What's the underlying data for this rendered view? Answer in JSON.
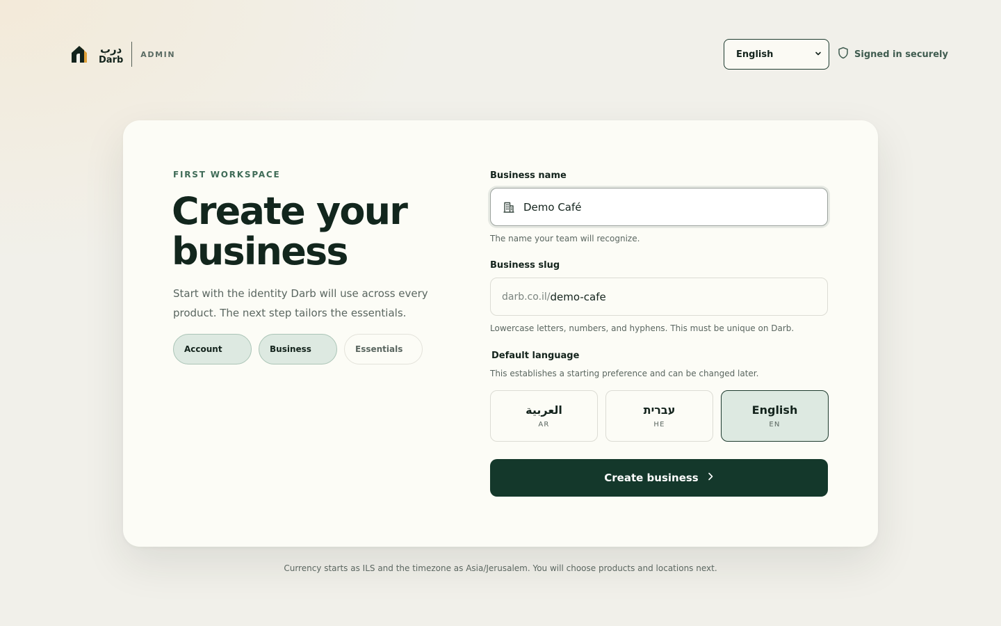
{
  "brand": {
    "name_ar": "درب",
    "name_en": "Darb",
    "section": "ADMIN"
  },
  "header": {
    "language_selected": "English",
    "secure_label": "Signed in securely"
  },
  "intro": {
    "eyebrow": "FIRST WORKSPACE",
    "title": "Create your business",
    "description": "Start with the identity Darb will use across every product. The next step tailors the essentials.",
    "steps": [
      {
        "label": "Account",
        "state": "done"
      },
      {
        "label": "Business",
        "state": "current"
      },
      {
        "label": "Essentials",
        "state": "upcoming"
      }
    ]
  },
  "form": {
    "business_name": {
      "label": "Business name",
      "value": "Demo Café",
      "hint": "The name your team will recognize."
    },
    "business_slug": {
      "label": "Business slug",
      "prefix": "darb.co.il/",
      "value": "demo-cafe",
      "hint": "Lowercase letters, numbers, and hyphens. This must be unique on Darb."
    },
    "default_language": {
      "label": "Default language",
      "hint": "This establishes a starting preference and can be changed later.",
      "options": [
        {
          "name": "العربية",
          "code": "AR"
        },
        {
          "name": "עברית",
          "code": "HE"
        },
        {
          "name": "English",
          "code": "EN"
        }
      ],
      "selected": "EN"
    },
    "submit_label": "Create business"
  },
  "footer": {
    "note": "Currency starts as ILS and the timezone as Asia/Jerusalem. You will choose products and locations next."
  },
  "colors": {
    "accent_dark": "#14382b",
    "accent_light": "#dde9e1",
    "background": "#f1f0ea",
    "card": "#fcfcf6"
  },
  "icons": {
    "brand": "darb-logo-icon",
    "secure": "shield-icon",
    "business": "building-icon",
    "submit": "chevron-right-icon",
    "select": "chevron-down-icon"
  }
}
